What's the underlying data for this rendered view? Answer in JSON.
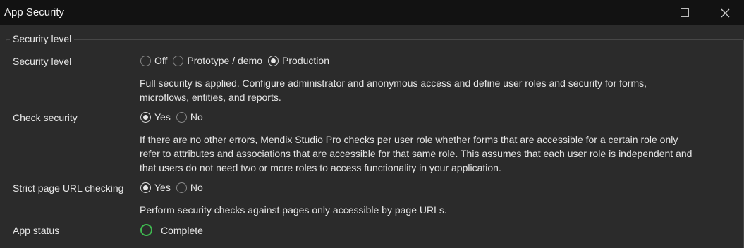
{
  "window": {
    "title": "App Security"
  },
  "group": {
    "legend": "Security level"
  },
  "security_level": {
    "label": "Security level",
    "options": [
      "Off",
      "Prototype / demo",
      "Production"
    ],
    "selected": "Production",
    "description_line1": "Full security is applied. Configure administrator and anonymous access and define user roles and security for forms,",
    "description_line2": "microflows, entities, and reports."
  },
  "check_security": {
    "label": "Check security",
    "options": [
      "Yes",
      "No"
    ],
    "selected": "Yes",
    "description_line1": "If there are no other errors, Mendix Studio Pro checks per user role whether forms that are accessible for a certain role only",
    "description_line2": "refer to attributes and associations that are accessible for that same role. This assumes that each user role is independent and",
    "description_line3": "that users do not need two or more roles to access functionality in your application."
  },
  "strict_url": {
    "label": "Strict page URL checking",
    "options": [
      "Yes",
      "No"
    ],
    "selected": "Yes",
    "description": "Perform security checks against pages only accessible by page URLs."
  },
  "app_status": {
    "label": "App status",
    "value": "Complete",
    "icon": "status-complete-icon",
    "color": "#3fb950"
  }
}
